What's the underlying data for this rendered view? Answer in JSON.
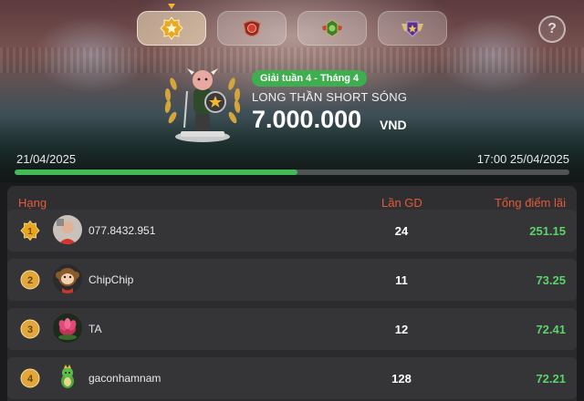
{
  "tabs": [
    {
      "icon": "gold-star-medal-icon",
      "active": true
    },
    {
      "icon": "red-shield-medal-icon",
      "active": false
    },
    {
      "icon": "green-winged-medal-icon",
      "active": false
    },
    {
      "icon": "purple-winged-medal-icon",
      "active": false
    }
  ],
  "help": {
    "label": "?",
    "icon": "help-icon"
  },
  "tournament": {
    "badge": "Giải tuần 4 - Tháng 4",
    "title": "LONG THẦN SHORT SÓNG",
    "prize": "7.000.000",
    "prize_unit": "VND",
    "start_date": "21/04/2025",
    "end_date": "17:00 25/04/2025",
    "progress_fraction": 0.51
  },
  "leaderboard": {
    "headers": {
      "rank": "Hạng",
      "trades": "Lần GD",
      "points": "Tổng điểm lãi"
    },
    "rows": [
      {
        "rank": "1",
        "name": "077.8432.951",
        "trades": "24",
        "points": "251.15"
      },
      {
        "rank": "2",
        "name": "ChipChip",
        "trades": "11",
        "points": "73.25"
      },
      {
        "rank": "3",
        "name": "TA",
        "trades": "12",
        "points": "72.41"
      },
      {
        "rank": "4",
        "name": "gaconhamnam",
        "trades": "128",
        "points": "72.21"
      }
    ]
  },
  "colors": {
    "accent_green": "#44b957",
    "header_red": "#e25a3a",
    "gold": "#f2b632"
  }
}
